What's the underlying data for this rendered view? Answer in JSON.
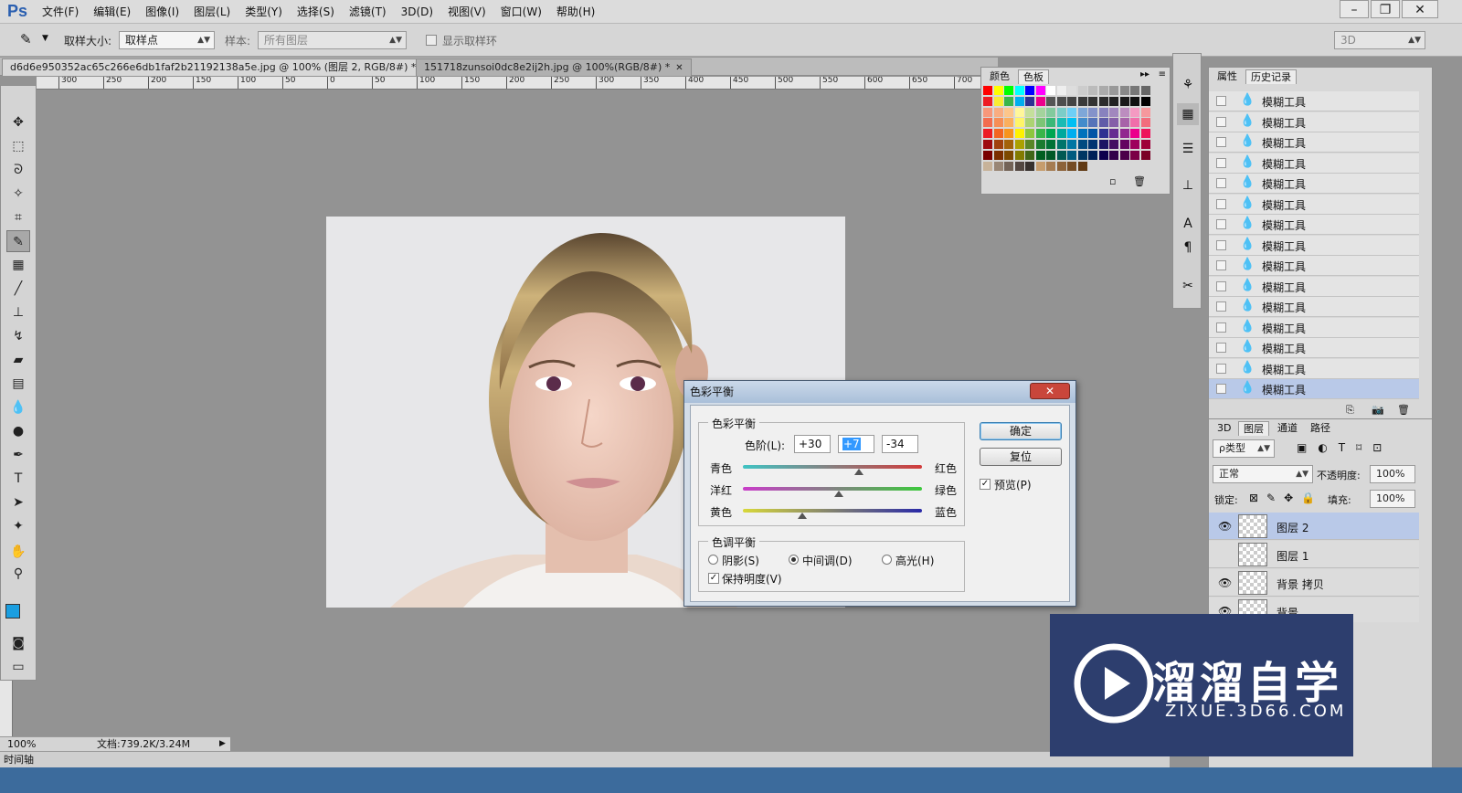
{
  "app": {
    "logo": "Ps"
  },
  "menubar": {
    "items": [
      "文件(F)",
      "编辑(E)",
      "图像(I)",
      "图层(L)",
      "类型(Y)",
      "选择(S)",
      "滤镜(T)",
      "3D(D)",
      "视图(V)",
      "窗口(W)",
      "帮助(H)"
    ],
    "min": "–",
    "max": "❐",
    "close": "✕"
  },
  "options": {
    "sample_size_label": "取样大小:",
    "sample_size_value": "取样点",
    "sample_label": "样本:",
    "sample_value": "所有图层",
    "show_ring_label": "显示取样环",
    "workspace": "3D"
  },
  "tabs": [
    {
      "label": "d6d6e950352ac65c266e6db1faf2b21192138a5e.jpg @ 100% (图层 2, RGB/8#) *",
      "close": "✕"
    },
    {
      "label": "151718zunsoi0dc8e2ij2h.jpg @ 100%(RGB/8#) *",
      "close": "✕"
    }
  ],
  "ruler": {
    "ticks": [
      "300",
      "250",
      "200",
      "150",
      "100",
      "50",
      "0",
      "50",
      "100",
      "150",
      "200",
      "250",
      "300",
      "350",
      "400",
      "450",
      "500",
      "550",
      "600",
      "650",
      "700"
    ]
  },
  "status": {
    "zoom": "100%",
    "doc": "文档:739.2K/3.24M",
    "timeline": "时间轴"
  },
  "dialog": {
    "title": "色彩平衡",
    "close": "✕",
    "balance_group": "色彩平衡",
    "levels_label": "色阶(L):",
    "levels": [
      "+30",
      "+7",
      "-34"
    ],
    "sliders": [
      {
        "left": "青色",
        "right": "红色",
        "value": 30
      },
      {
        "left": "洋红",
        "right": "绿色",
        "value": 7
      },
      {
        "left": "黄色",
        "right": "蓝色",
        "value": -34
      }
    ],
    "tone_group": "色调平衡",
    "shadows": "阴影(S)",
    "midtones": "中间调(D)",
    "highlights": "高光(H)",
    "preserve": "保持明度(V)",
    "ok": "确定",
    "reset": "复位",
    "preview": "预览(P)",
    "preview_checked": "✓",
    "preserve_checked": "✓"
  },
  "swatch_panel": {
    "tab_color": "颜色",
    "tab_swatches": "色板"
  },
  "history_panel": {
    "tab_props": "属性",
    "tab_history": "历史记录",
    "items": [
      "模糊工具",
      "模糊工具",
      "模糊工具",
      "模糊工具",
      "模糊工具",
      "模糊工具",
      "模糊工具",
      "模糊工具",
      "模糊工具",
      "模糊工具",
      "模糊工具",
      "模糊工具",
      "模糊工具",
      "模糊工具",
      "模糊工具"
    ]
  },
  "layers_panel": {
    "tabs": [
      "3D",
      "图层",
      "通道",
      "路径"
    ],
    "kind_filter": "ρ类型",
    "blend_mode": "正常",
    "opacity_label": "不透明度:",
    "opacity": "100%",
    "lock_label": "锁定:",
    "fill_label": "填充:",
    "fill": "100%",
    "layers": [
      {
        "name": "图层 2",
        "visible": true
      },
      {
        "name": "图层 1",
        "visible": false
      },
      {
        "name": "背景 拷贝",
        "visible": true
      },
      {
        "name": "背景",
        "visible": true
      }
    ]
  },
  "watermark": {
    "title": "溜溜自学",
    "url": "ZIXUE.3D66.COM"
  },
  "colors": {
    "foreground": "#1a9ee0",
    "background": "#000000",
    "accent": "#3399ff"
  }
}
